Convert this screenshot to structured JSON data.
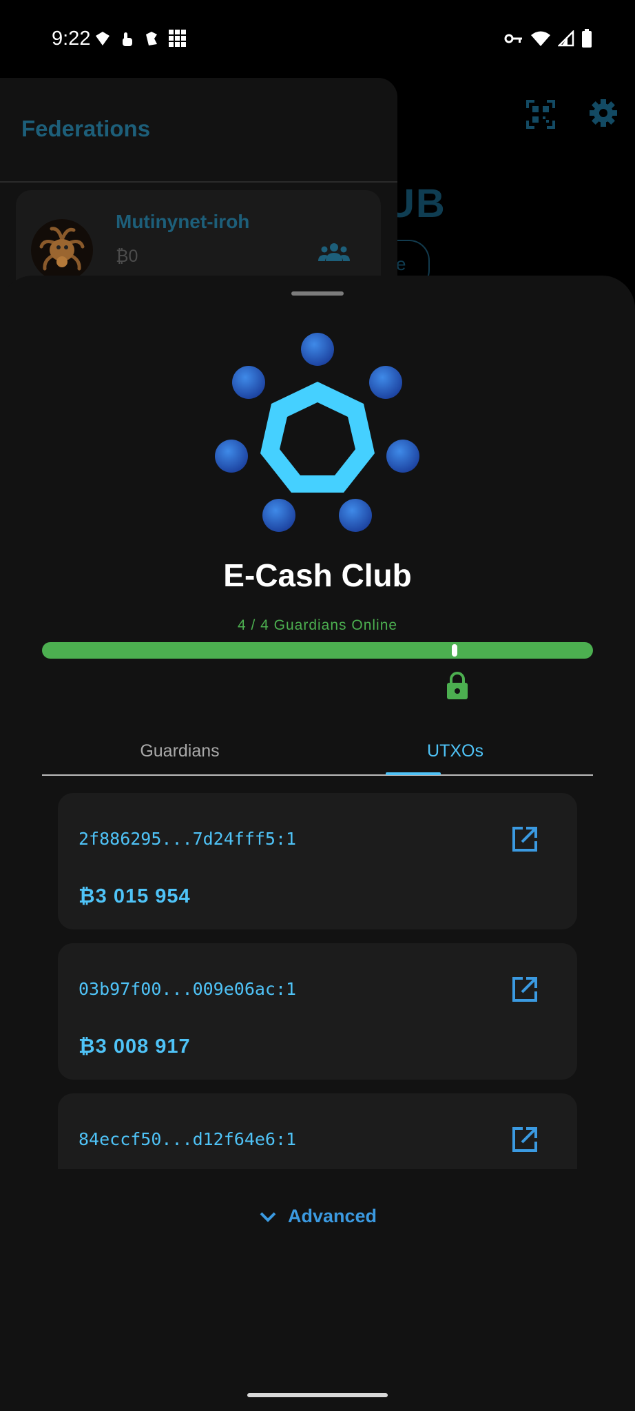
{
  "status_bar": {
    "time": "9:22"
  },
  "background": {
    "drawer_title": "Federations",
    "federation_name": "Mutinynet-iroh",
    "federation_balance": "₿0",
    "title_fragment": "UB",
    "pill_fragment": "ve"
  },
  "sheet": {
    "federation_name": "E-Cash Club",
    "guardians_online": "4 / 4 Guardians Online",
    "tabs": [
      {
        "label": "Guardians",
        "selected": false
      },
      {
        "label": "UTXOs",
        "selected": true
      }
    ],
    "utxos": [
      {
        "id": "2f886295...7d24fff5:1",
        "amount": "₿3 015 954"
      },
      {
        "id": "03b97f00...009e06ac:1",
        "amount": "₿3 008 917"
      },
      {
        "id": "84eccf50...d12f64e6:1",
        "amount": ""
      }
    ],
    "advanced_label": "Advanced"
  },
  "colors": {
    "accent": "#4fc3f7",
    "online_green": "#4caf50",
    "link_blue": "#3b9ae1"
  }
}
